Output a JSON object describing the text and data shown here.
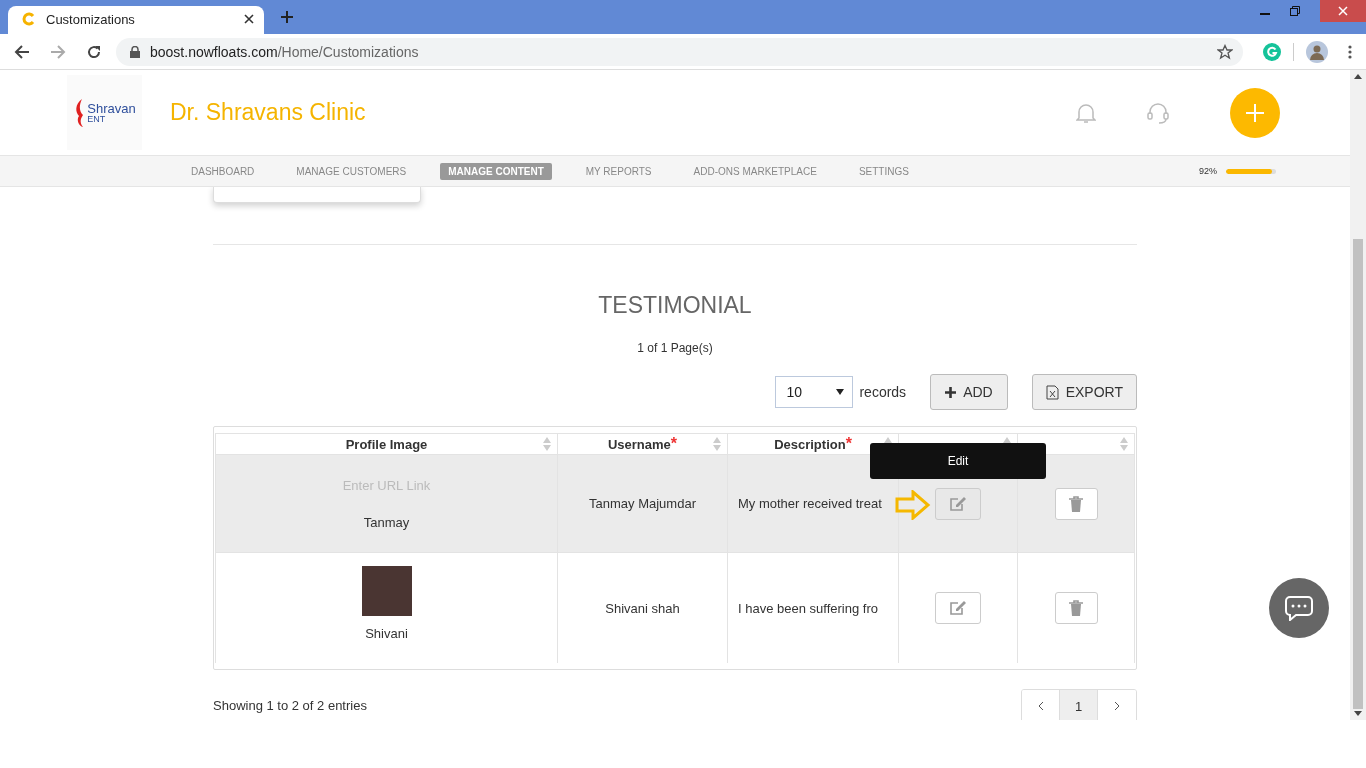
{
  "browser": {
    "tab_title": "Customizations",
    "address_host": "boost.nowfloats.com",
    "address_path": "/Home/Customizations"
  },
  "header": {
    "logo_name": "Shravan",
    "logo_sub": "ENT",
    "title": "Dr. Shravans Clinic"
  },
  "nav": [
    {
      "label": "DASHBOARD",
      "selected": false
    },
    {
      "label": "MANAGE CUSTOMERS",
      "selected": false
    },
    {
      "label": "MANAGE CONTENT",
      "selected": true
    },
    {
      "label": "MY REPORTS",
      "selected": false
    },
    {
      "label": "ADD-ONS MARKETPLACE",
      "selected": false
    },
    {
      "label": "SETTINGS",
      "selected": false
    }
  ],
  "progress": {
    "label": "92%",
    "level": 0.92
  },
  "section": {
    "title": "TESTIMONIAL",
    "page_info": "1 of 1 Page(s)",
    "page_size": "10",
    "records_label": "records",
    "add_button": "ADD",
    "export_button": "EXPORT"
  },
  "table": {
    "columns": [
      {
        "label": "Profile Image",
        "sortable": true
      },
      {
        "label": "Username",
        "required_mark": "*",
        "sortable": true
      },
      {
        "label": "Description",
        "required_mark": "*",
        "sortable": true
      },
      {
        "sortable": true
      },
      {
        "sortable": true
      }
    ],
    "rows": [
      {
        "kind": "url_field",
        "image_placeholder": "Enter URL Link",
        "name": "Tanmay",
        "username": "Tanmay Majumdar",
        "description": "My mother received treat",
        "highlighted": true,
        "tooltip": "Edit"
      },
      {
        "kind": "photo",
        "name": "Shivani",
        "username": "Shivani shah",
        "description": "I have been suffering fro",
        "highlighted": false
      }
    ]
  },
  "footer": {
    "info": "Showing 1 to 2 of 2 entries",
    "pages": [
      {
        "label": "1",
        "selected": true
      }
    ]
  }
}
